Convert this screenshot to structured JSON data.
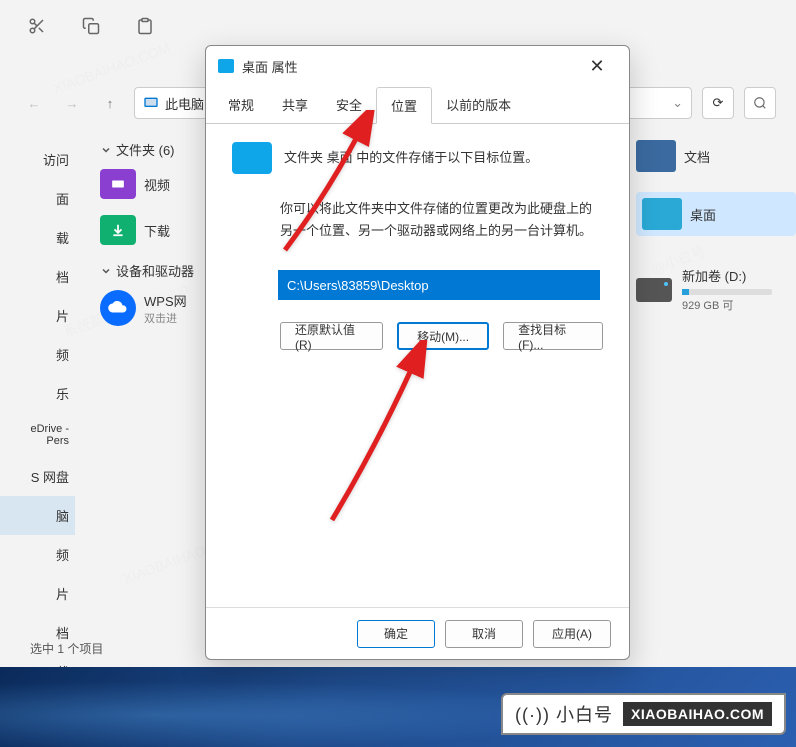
{
  "toolbar": {
    "item1": "",
    "item2": ""
  },
  "nav": {
    "breadcrumb": "此电脑"
  },
  "sidebar": {
    "items": [
      "访问",
      "面",
      "载",
      "档",
      "片",
      "频",
      "乐",
      "eDrive - Pers",
      "S 网盘",
      "脑",
      "频",
      "片",
      "档",
      "载"
    ]
  },
  "mid": {
    "folders_header": "文件夹 (6)",
    "items": [
      "视频",
      "下载"
    ],
    "devices_header": "设备和驱动器",
    "wps_name": "WPS网",
    "wps_sub": "双击进"
  },
  "right": {
    "docs": "文档",
    "desktop": "桌面",
    "drive_name": "新加卷 (D:)",
    "drive_free": "929 GB 可"
  },
  "statusbar": "选中 1 个项目",
  "dialog": {
    "title": "桌面 属性",
    "tabs": [
      "常规",
      "共享",
      "安全",
      "位置",
      "以前的版本"
    ],
    "active_tab_index": 3,
    "info_text": "文件夹 桌面 中的文件存储于以下目标位置。",
    "desc_text": "你可以将此文件夹中文件存储的位置更改为此硬盘上的另一个位置、另一个驱动器或网络上的另一台计算机。",
    "path": "C:\\Users\\83859\\Desktop",
    "buttons": {
      "restore": "还原默认值(R)",
      "move": "移动(M)...",
      "find": "查找目标(F)..."
    },
    "footer": {
      "ok": "确定",
      "cancel": "取消",
      "apply": "应用(A)"
    }
  },
  "badge": {
    "logo": "((·)) 小白号",
    "url": "XIAOBAIHAO.COM"
  }
}
